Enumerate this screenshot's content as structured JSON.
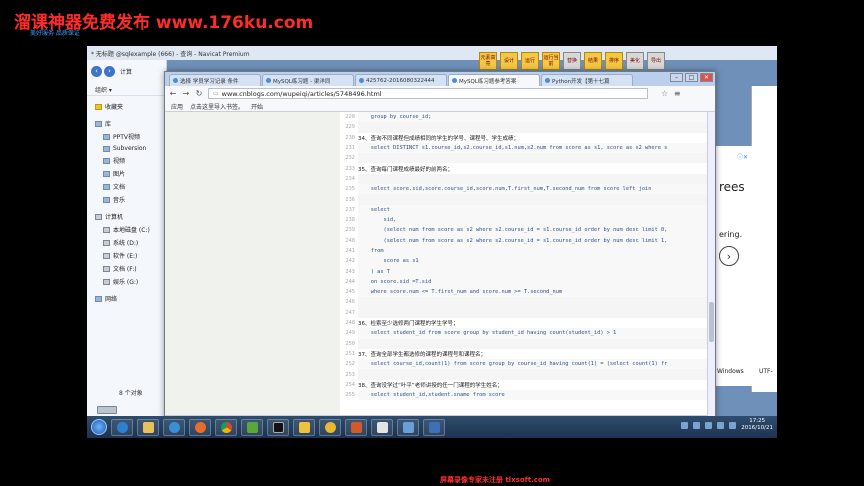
{
  "watermark": {
    "top_text": "溜课神器免费发布 www.176ku.com",
    "top_small": "美好服务 品质保证",
    "bottom_text": "屏幕录像专家未注册 tlxsoft.com"
  },
  "navicat": {
    "title": "* 无标题 @sqlexample (666) - 查询 - Navicat Premium",
    "toolbar": [
      "元素高亮",
      "设计",
      "运行",
      "运行当前",
      "替换",
      "结果",
      "排序",
      "美化",
      "导出"
    ],
    "ad_text_1": "rees",
    "ad_text_2": "ering.",
    "status_left": "Windows",
    "status_right": "UTF-"
  },
  "explorer": {
    "address": "计算",
    "organize": "组织 ▾",
    "favorites": "收藏夹",
    "library_header": "库",
    "library_items": [
      "PPTV视频",
      "Subversion",
      "视频",
      "图片",
      "文档",
      "音乐"
    ],
    "computer_header": "计算机",
    "drives": [
      "本地磁盘 (C:)",
      "系统 (D:)",
      "软件 (E:)",
      "文档 (F:)",
      "娱乐 (G:)"
    ],
    "network": "网络",
    "object_count": "8 个对象"
  },
  "chrome": {
    "tabs": [
      {
        "label": "选择 学员学习记录 条件"
      },
      {
        "label": "MySQL练习题 - 渠洋同"
      },
      {
        "label": "425762-2016080322444"
      },
      {
        "label": "MySQL练习题参考答案",
        "active": true
      },
      {
        "label": "Python开发【第十七篇"
      }
    ],
    "url": "www.cnblogs.com/wupeiqi/articles/5748496.html",
    "bookmarks": [
      "应用",
      "点击这里导入书签。",
      "开始"
    ]
  },
  "code_lines": [
    {
      "n": "228",
      "text": "    group by course_id;",
      "type": "code"
    },
    {
      "n": "229",
      "text": "",
      "type": "blank"
    },
    {
      "n": "230",
      "text": "34、查询不同课程但成绩相同的学生的学号、课程号、学生成绩；",
      "type": "hdr"
    },
    {
      "n": "231",
      "text": "    select DISTINCT s1.course_id,s2.course_id,s1.num,s2.num from score as s1, score as s2 where s",
      "type": "code"
    },
    {
      "n": "232",
      "text": "",
      "type": "blank"
    },
    {
      "n": "233",
      "text": "35、查询每门课程成绩最好的前两名；",
      "type": "hdr"
    },
    {
      "n": "234",
      "text": "",
      "type": "blank"
    },
    {
      "n": "235",
      "text": "    select score.sid,score.course_id,score.num,T.first_num,T.second_num from score left join",
      "type": "code"
    },
    {
      "n": "236",
      "text": "",
      "type": "blank"
    },
    {
      "n": "237",
      "text": "    select",
      "type": "code"
    },
    {
      "n": "238",
      "text": "        sid,",
      "type": "code"
    },
    {
      "n": "239",
      "text": "        (select num from score as s2 where s2.course_id = s1.course_id order by num desc limit 0,",
      "type": "code"
    },
    {
      "n": "240",
      "text": "        (select num from score as s2 where s2.course_id = s1.course_id order by num desc limit 1,",
      "type": "code"
    },
    {
      "n": "241",
      "text": "    from",
      "type": "code"
    },
    {
      "n": "242",
      "text": "        score as s1",
      "type": "code"
    },
    {
      "n": "243",
      "text": "    ) as T",
      "type": "code"
    },
    {
      "n": "244",
      "text": "    on score.sid =T.sid",
      "type": "code"
    },
    {
      "n": "245",
      "text": "    where score.num <= T.first_num and score.num >= T.second_num",
      "type": "code"
    },
    {
      "n": "246",
      "text": "",
      "type": "blank"
    },
    {
      "n": "247",
      "text": "",
      "type": "blank"
    },
    {
      "n": "248",
      "text": "36、检索至少选修两门课程的学生学号；",
      "type": "hdr"
    },
    {
      "n": "249",
      "text": "    select student_id from score group by student_id having count(student_id) > 1",
      "type": "code"
    },
    {
      "n": "250",
      "text": "",
      "type": "blank"
    },
    {
      "n": "251",
      "text": "37、查询全部学生都选修的课程的课程号和课程名；",
      "type": "hdr"
    },
    {
      "n": "252",
      "text": "    select course_id,count(1) from score group by course_id having count(1) = (select count(1) fr",
      "type": "code"
    },
    {
      "n": "253",
      "text": "",
      "type": "blank"
    },
    {
      "n": "254",
      "text": "38、查询没学过“叶平”老师讲授的任一门课程的学生姓名；",
      "type": "hdr"
    },
    {
      "n": "255",
      "text": "    select student_id,student.sname from score",
      "type": "code"
    }
  ],
  "taskbar": {
    "time": "17:25",
    "date": "2016/10/21"
  }
}
